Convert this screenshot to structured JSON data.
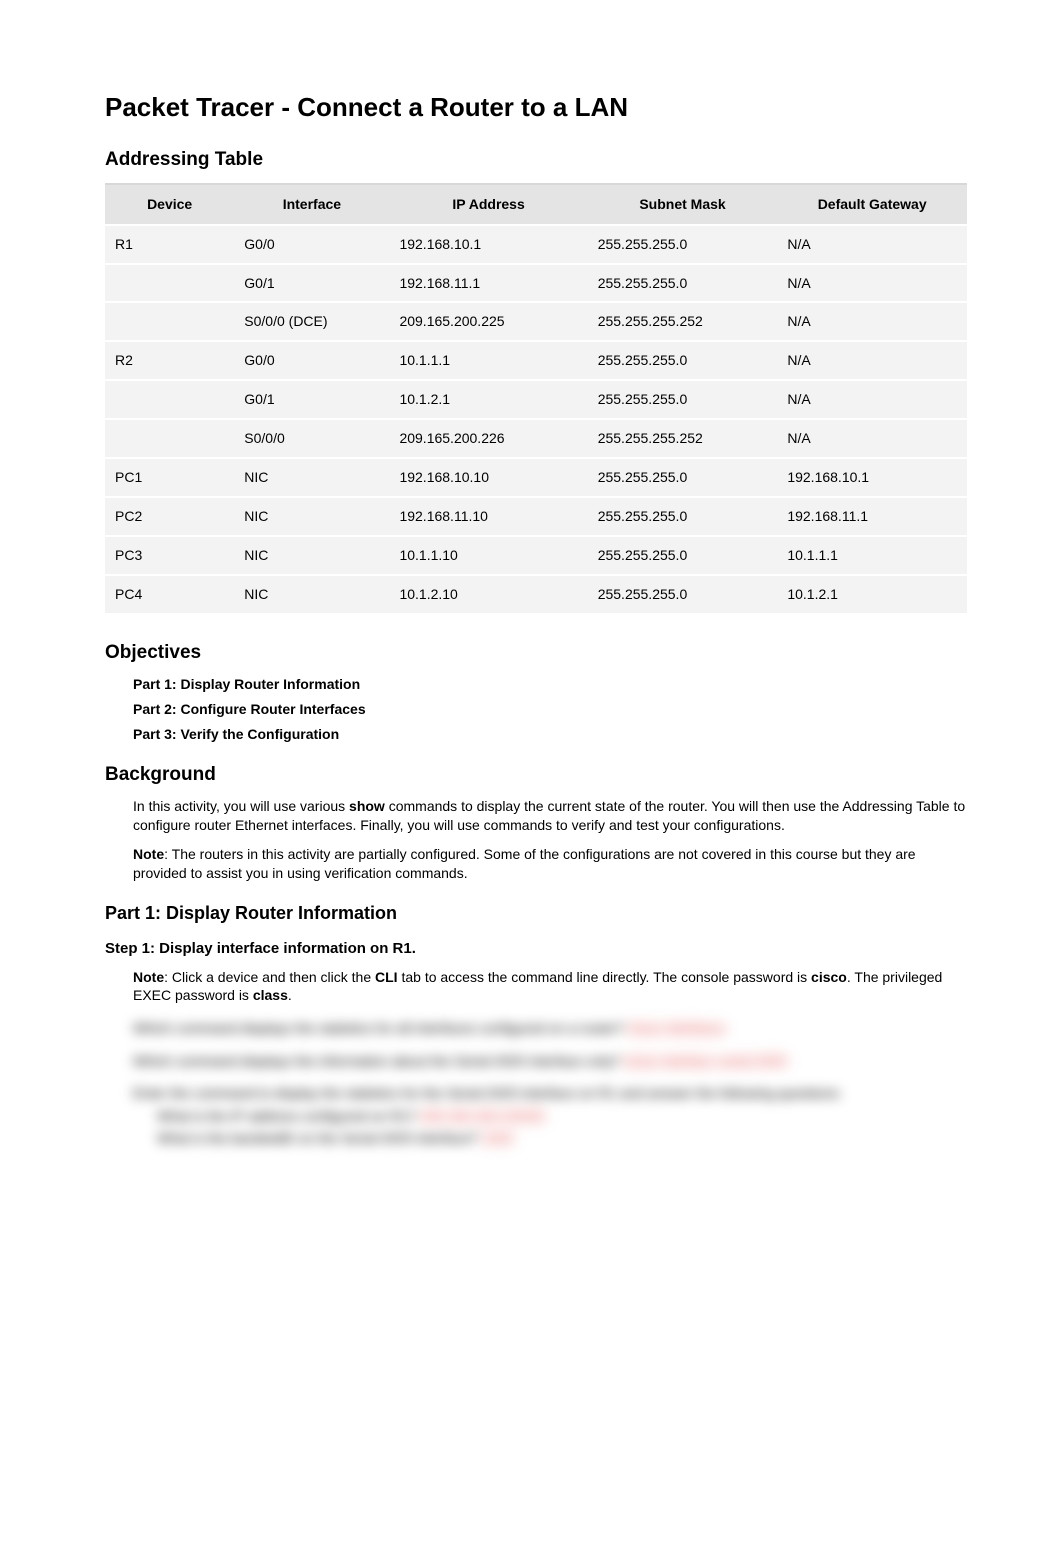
{
  "title": "Packet Tracer - Connect a Router to a LAN",
  "addressing": {
    "heading": "Addressing Table",
    "columns": [
      "Device",
      "Interface",
      "IP Address",
      "Subnet Mask",
      "Default Gateway"
    ],
    "rows": [
      {
        "device": "R1",
        "interface": "G0/0",
        "ip": "192.168.10.1",
        "mask": "255.255.255.0",
        "gw": "N/A"
      },
      {
        "device": "",
        "interface": "G0/1",
        "ip": "192.168.11.1",
        "mask": "255.255.255.0",
        "gw": "N/A"
      },
      {
        "device": "",
        "interface": "S0/0/0 (DCE)",
        "ip": "209.165.200.225",
        "mask": "255.255.255.252",
        "gw": "N/A"
      },
      {
        "device": "R2",
        "interface": "G0/0",
        "ip": "10.1.1.1",
        "mask": "255.255.255.0",
        "gw": "N/A"
      },
      {
        "device": "",
        "interface": "G0/1",
        "ip": "10.1.2.1",
        "mask": "255.255.255.0",
        "gw": "N/A"
      },
      {
        "device": "",
        "interface": "S0/0/0",
        "ip": "209.165.200.226",
        "mask": "255.255.255.252",
        "gw": "N/A"
      },
      {
        "device": "PC1",
        "interface": "NIC",
        "ip": "192.168.10.10",
        "mask": "255.255.255.0",
        "gw": "192.168.10.1"
      },
      {
        "device": "PC2",
        "interface": "NIC",
        "ip": "192.168.11.10",
        "mask": "255.255.255.0",
        "gw": "192.168.11.1"
      },
      {
        "device": "PC3",
        "interface": "NIC",
        "ip": "10.1.1.10",
        "mask": "255.255.255.0",
        "gw": "10.1.1.1"
      },
      {
        "device": "PC4",
        "interface": "NIC",
        "ip": "10.1.2.10",
        "mask": "255.255.255.0",
        "gw": "10.1.2.1"
      }
    ]
  },
  "objectives": {
    "heading": "Objectives",
    "items": [
      "Part 1: Display Router Information",
      "Part 2: Configure Router Interfaces",
      "Part 3: Verify the Configuration"
    ]
  },
  "background": {
    "heading": "Background",
    "p1_a": "In this activity, you will use various ",
    "p1_bold": "show",
    "p1_b": " commands to display the current state of the router. You will then use the Addressing Table to configure router Ethernet interfaces. Finally, you will use commands to verify and test your configurations.",
    "p2_bold": "Note",
    "p2_rest": ": The routers in this activity are partially configured. Some of the configurations are not covered in this course but they are provided to assist you in using verification commands."
  },
  "part1": {
    "heading": "Part 1: Display Router Information",
    "step1_heading": "Step 1: Display interface information on R1.",
    "note_bold": "Note",
    "note_a": ": Click a device and then click the ",
    "note_cli": "CLI",
    "note_b": " tab to access the command line directly. The console password is ",
    "note_pw1": "cisco",
    "note_c": ". The privileged EXEC password is ",
    "note_pw2": "class",
    "note_d": "."
  },
  "blurred": {
    "q1": "Which command displays the statistics for all interfaces configured on a router?",
    "a1": "show interfaces",
    "q2": "Which command displays the information about the Serial 0/0/0 interface only?",
    "a2": "show interface serial 0/0/0",
    "q3": "Enter the command to display the statistics for the Serial 0/0/0 interface on R1 and answer the following questions:",
    "q3a": "What is the IP address configured on R1?",
    "a3a": "209.165.200.225/30",
    "q3b": "What is the bandwidth on the Serial 0/0/0 interface?",
    "a3b": "1544"
  }
}
